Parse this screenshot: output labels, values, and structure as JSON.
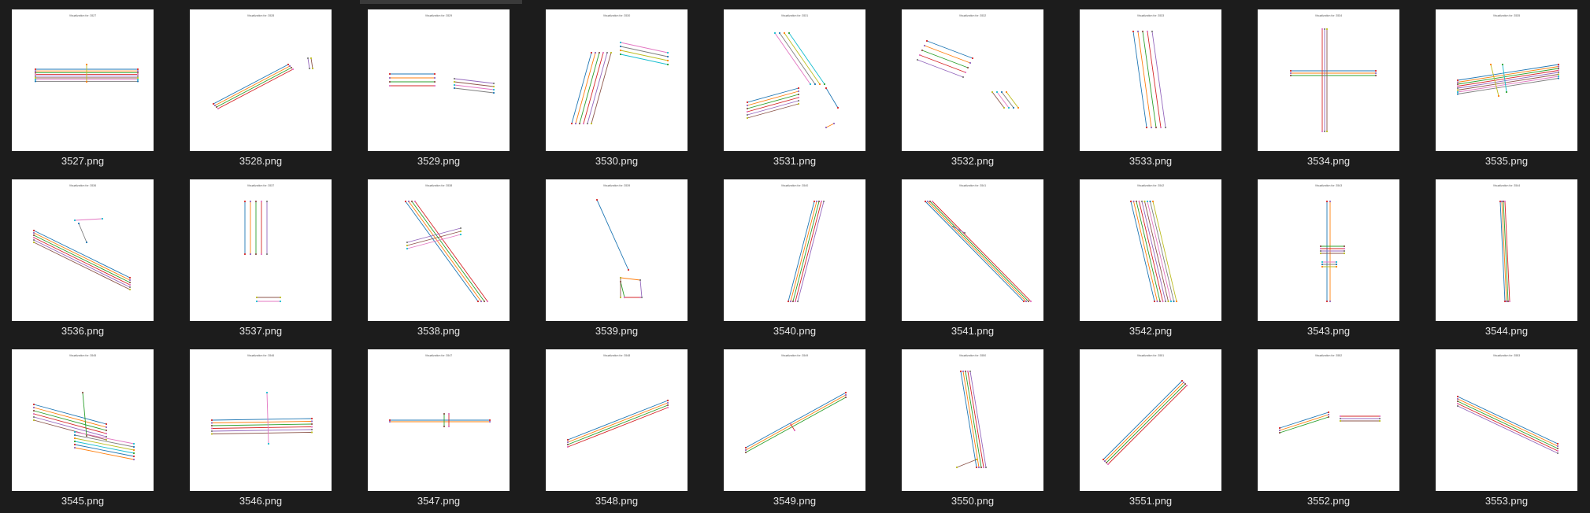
{
  "view": {
    "background": "#1c1c1c",
    "caption_color": "#e6e6e6"
  },
  "items": [
    {
      "file": "3527.png",
      "title": "Visualization for: 3527"
    },
    {
      "file": "3528.png",
      "title": "Visualization for: 3528"
    },
    {
      "file": "3529.png",
      "title": "Visualization for: 3529"
    },
    {
      "file": "3530.png",
      "title": "Visualization for: 3530"
    },
    {
      "file": "3531.png",
      "title": "Visualization for: 3531"
    },
    {
      "file": "3532.png",
      "title": "Visualization for: 3532"
    },
    {
      "file": "3533.png",
      "title": "Visualization for: 3533"
    },
    {
      "file": "3534.png",
      "title": "Visualization for: 3534"
    },
    {
      "file": "3535.png",
      "title": "Visualization for: 3535"
    },
    {
      "file": "3536.png",
      "title": "Visualization for: 3536"
    },
    {
      "file": "3537.png",
      "title": "Visualization for: 3537"
    },
    {
      "file": "3538.png",
      "title": "Visualization for: 3538"
    },
    {
      "file": "3539.png",
      "title": "Visualization for: 3539"
    },
    {
      "file": "3540.png",
      "title": "Visualization for: 3540"
    },
    {
      "file": "3541.png",
      "title": "Visualization for: 3541"
    },
    {
      "file": "3542.png",
      "title": "Visualization for: 3542"
    },
    {
      "file": "3543.png",
      "title": "Visualization for: 3543"
    },
    {
      "file": "3544.png",
      "title": "Visualization for: 3544"
    },
    {
      "file": "3545.png",
      "title": "Visualization for: 3545"
    },
    {
      "file": "3546.png",
      "title": "Visualization for: 3546"
    },
    {
      "file": "3547.png",
      "title": "Visualization for: 3547"
    },
    {
      "file": "3548.png",
      "title": "Visualization for: 3548"
    },
    {
      "file": "3549.png",
      "title": "Visualization for: 3549"
    },
    {
      "file": "3550.png",
      "title": "Visualization for: 3550"
    },
    {
      "file": "3551.png",
      "title": "Visualization for: 3551"
    },
    {
      "file": "3552.png",
      "title": "Visualization for: 3552"
    },
    {
      "file": "3553.png",
      "title": "Visualization for: 3553"
    }
  ]
}
